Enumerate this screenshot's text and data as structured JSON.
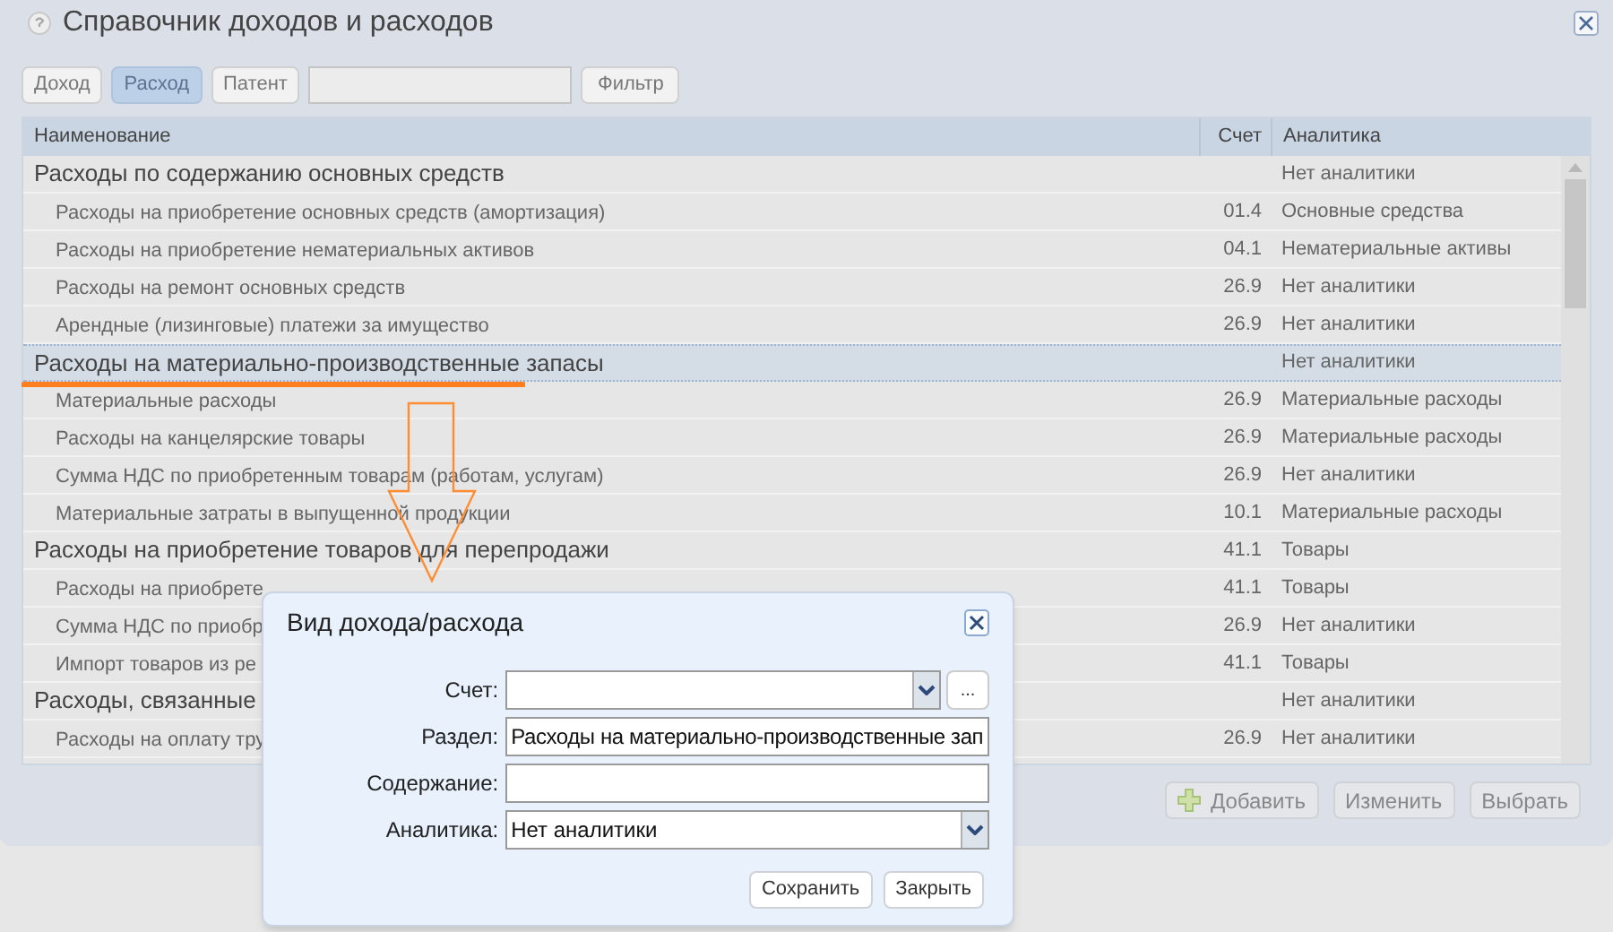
{
  "window": {
    "title": "Справочник доходов и расходов"
  },
  "toolbar": {
    "filters": [
      {
        "label": "Доход",
        "selected": false
      },
      {
        "label": "Расход",
        "selected": true
      },
      {
        "label": "Патент",
        "selected": false
      }
    ],
    "filter_button": "Фильтр"
  },
  "table": {
    "columns": [
      "Наименование",
      "Счет",
      "Аналитика"
    ],
    "rows": [
      {
        "kind": "group",
        "name": "Расходы по содержанию основных средств",
        "analytics": "Нет аналитики",
        "selected": false
      },
      {
        "kind": "item",
        "name": "Расходы на приобретение основных средств (амортизация)",
        "account": "01.4",
        "analytics": "Основные средства",
        "selected": false
      },
      {
        "kind": "item",
        "name": "Расходы на приобретение нематериальных активов",
        "account": "04.1",
        "analytics": "Нематериальные активы",
        "selected": false
      },
      {
        "kind": "item",
        "name": "Расходы на ремонт основных средств",
        "account": "26.9",
        "analytics": "Нет аналитики",
        "selected": false
      },
      {
        "kind": "item",
        "name": "Арендные (лизинговые) платежи за имущество",
        "account": "26.9",
        "analytics": "Нет аналитики",
        "selected": false
      },
      {
        "kind": "group",
        "name": "Расходы на материально-производственные запасы",
        "analytics": "Нет аналитики",
        "selected": true
      },
      {
        "kind": "item",
        "name": "Материальные расходы",
        "account": "26.9",
        "analytics": "Материальные расходы",
        "selected": false
      },
      {
        "kind": "item",
        "name": "Расходы на канцелярские товары",
        "account": "26.9",
        "analytics": "Материальные расходы",
        "selected": false
      },
      {
        "kind": "item",
        "name": "Сумма НДС по приобретенным товарам (работам, услугам)",
        "account": "26.9",
        "analytics": "Нет аналитики",
        "selected": false
      },
      {
        "kind": "item",
        "name": "Материальные затраты в выпущенной продукции",
        "account": "10.1",
        "analytics": "Материальные расходы",
        "selected": false
      },
      {
        "kind": "group",
        "name": "Расходы на приобретение товаров для перепродажи",
        "account": "41.1",
        "analytics": "Товары",
        "selected": false
      },
      {
        "kind": "item",
        "name": "Расходы на приобрете",
        "account": "41.1",
        "analytics": "Товары",
        "selected": false
      },
      {
        "kind": "item",
        "name": "Сумма НДС по приобр",
        "account": "26.9",
        "analytics": "Нет аналитики",
        "selected": false
      },
      {
        "kind": "item",
        "name": "Импорт товаров из ре",
        "account": "41.1",
        "analytics": "Товары",
        "selected": false
      },
      {
        "kind": "group",
        "name": "Расходы, связанные",
        "analytics": "Нет аналитики",
        "selected": false
      },
      {
        "kind": "item",
        "name": "Расходы на оплату тру",
        "account": "26.9",
        "analytics": "Нет аналитики",
        "selected": false
      }
    ]
  },
  "actions": [
    {
      "label": "Добавить",
      "kind": "add"
    },
    {
      "label": "Изменить",
      "kind": "plain"
    },
    {
      "label": "Выбрать",
      "kind": "plain"
    }
  ],
  "dialog": {
    "title": "Вид дохода/расхода",
    "fields": [
      {
        "label": "Счет:",
        "kind": "combo_browse",
        "browse": "..."
      },
      {
        "label": "Раздел:",
        "kind": "text",
        "value": "Расходы на материально-производственные зап"
      },
      {
        "label": "Содержание:",
        "kind": "text"
      },
      {
        "label": "Аналитика:",
        "kind": "select",
        "value": "Нет аналитики"
      }
    ],
    "buttons": [
      "Сохранить",
      "Закрыть"
    ]
  }
}
